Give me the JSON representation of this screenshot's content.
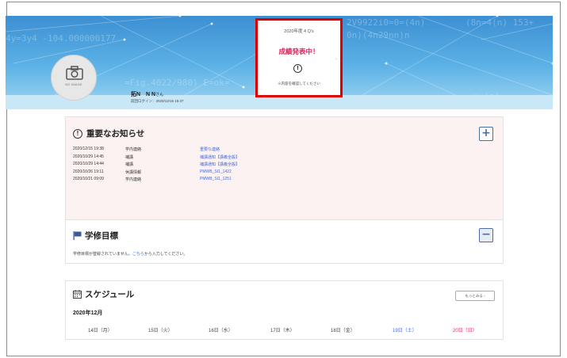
{
  "colors": {
    "banner": "#4aa3dd",
    "highlight_border": "#e00000",
    "published": "#e0245c",
    "link": "#3f6ad8",
    "saturday": "#3f6ad8",
    "sunday": "#e0245c",
    "notice_bg": "#fdf2f2"
  },
  "banner": {
    "formulas": [
      "4y=3y4 -104.000000177",
      "2V9922i0=0=(4n)",
      "0n)(4n29nn)n",
      "=Fig.4022/980) E=ok=",
      "(8n=4(n) 153+",
      "x-(n)"
    ]
  },
  "profile": {
    "avatar_icon": "camera-icon",
    "no_image": "NO IMAGE",
    "name": "拓N　N N",
    "honorific": "さん",
    "last_login": "前回ログイン：2020/12/16 15:37"
  },
  "popup": {
    "term": "2020年度 4 Q's",
    "status": "成績発表中！",
    "alert_icon": "alert-circle-icon",
    "alert_glyph": "!",
    "note": "※内容を確認してください",
    "arrow": "›"
  },
  "notices": {
    "icon": "alert-circle-icon",
    "icon_glyph": "!",
    "title": "重要なお知らせ",
    "toggle": "+",
    "rows": [
      {
        "date": "2020/12/15  19:38",
        "category": "学内連絡",
        "title": "重要な連絡"
      },
      {
        "date": "2020/10/29  14:45",
        "category": "補講",
        "title": "補講通知【講義全般】"
      },
      {
        "date": "2020/10/29  14:44",
        "category": "補講",
        "title": "補講通知【講義全般】"
      },
      {
        "date": "2020/10/26  19:11",
        "category": "休講情報",
        "title": "PMWB_SI1_1422"
      },
      {
        "date": "2020/10/21  09:09",
        "category": "学内連絡",
        "title": "PMWB_SI1_1251"
      }
    ]
  },
  "goals": {
    "icon": "flag-icon",
    "title": "学修目標",
    "toggle": "−",
    "text_before": "学修目標が登録されていません。",
    "link": "こちら",
    "text_after": "から入力してください。"
  },
  "schedule": {
    "icon": "calendar-icon",
    "title": "スケジュール",
    "more": "もっとみる ›",
    "month": "2020年12月",
    "days": [
      {
        "label": "14日（月）",
        "kind": "weekday"
      },
      {
        "label": "15日（火）",
        "kind": "weekday"
      },
      {
        "label": "16日（水）",
        "kind": "weekday"
      },
      {
        "label": "17日（木）",
        "kind": "weekday"
      },
      {
        "label": "18日（金）",
        "kind": "weekday"
      },
      {
        "label": "19日（土）",
        "kind": "saturday"
      },
      {
        "label": "20日（日）",
        "kind": "sunday"
      }
    ]
  }
}
